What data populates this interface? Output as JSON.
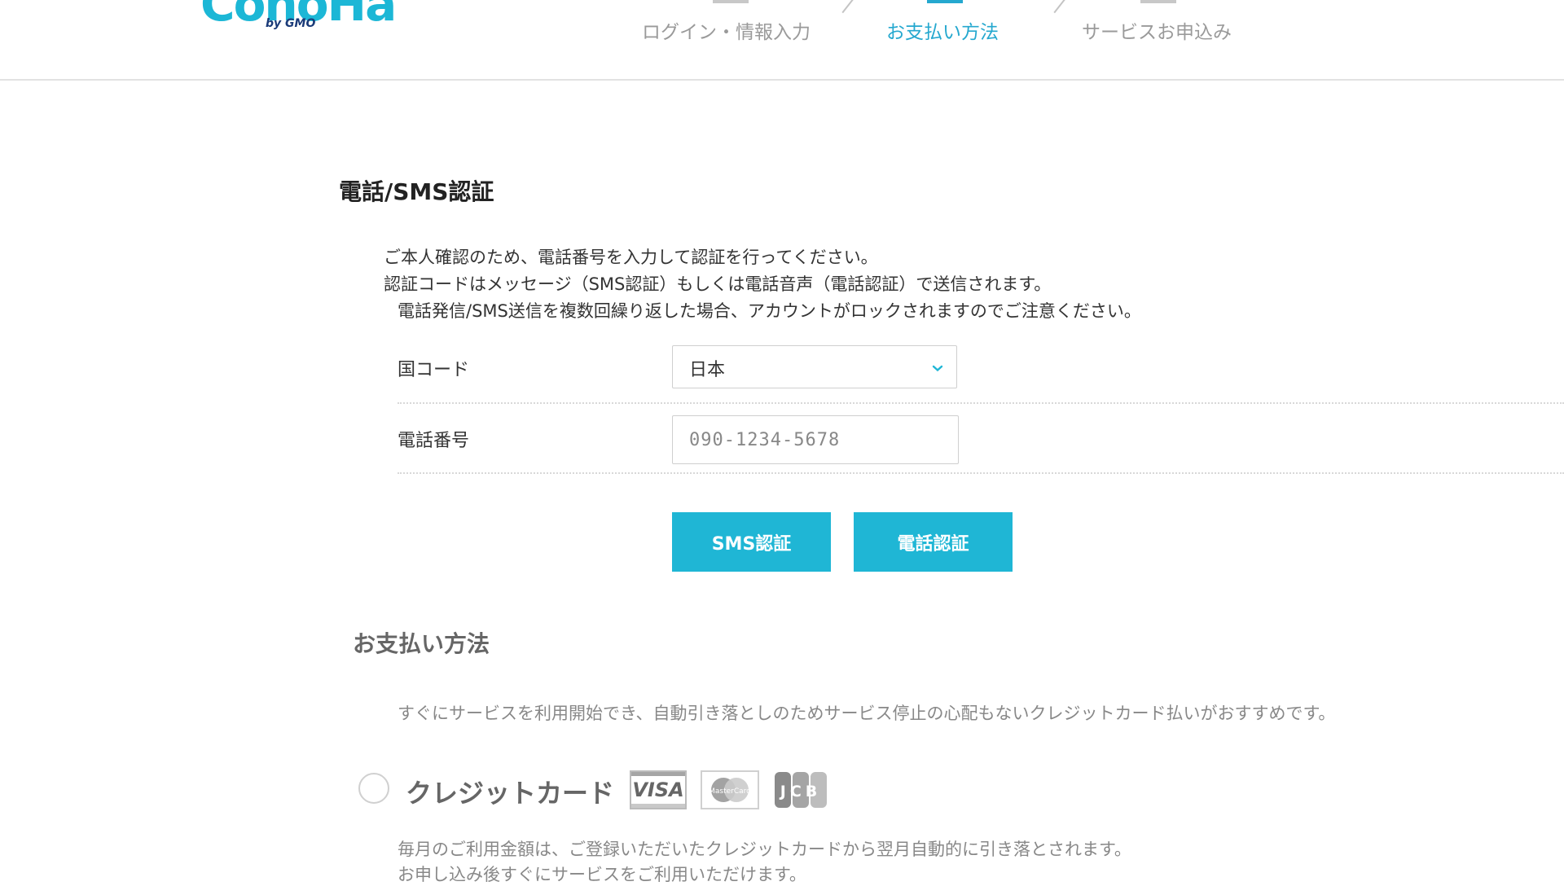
{
  "header": {
    "logo": {
      "text": "ConoHa",
      "by": "by GMO"
    },
    "steps": [
      {
        "label": "ログイン・情報入力",
        "active": false
      },
      {
        "label": "お支払い方法",
        "active": true
      },
      {
        "label": "サービスお申込み",
        "active": false
      }
    ]
  },
  "sms": {
    "title": "電話/SMS認証",
    "desc": [
      "ご本人確認のため、電話番号を入力して認証を行ってください。",
      "認証コードはメッセージ（SMS認証）もしくは電話音声（電話認証）で送信されます。",
      "電話発信/SMS送信を複数回繰り返した場合、アカウントがロックされますのでご注意ください。"
    ],
    "country_label": "国コード",
    "country_value": "日本",
    "phone_label": "電話番号",
    "phone_placeholder": "090-1234-5678",
    "sms_button": "SMS認証",
    "call_button": "電話認証"
  },
  "payment": {
    "title": "お支払い方法",
    "desc": "すぐにサービスを利用開始でき、自動引き落としのためサービス停止の心配もないクレジットカード払いがおすすめです。",
    "credit_card_label": "クレジットカード",
    "card_brands": [
      "VISA",
      "MasterCard",
      "JCB"
    ],
    "card_note": [
      "毎月のご利用金額は、ご登録いただいたクレジットカードから翌月自動的に引き落とされます。",
      "お申し込み後すぐにサービスをご利用いただけます。"
    ]
  },
  "colors": {
    "accent": "#1fb6d5",
    "step_active": "#25a8cf"
  }
}
